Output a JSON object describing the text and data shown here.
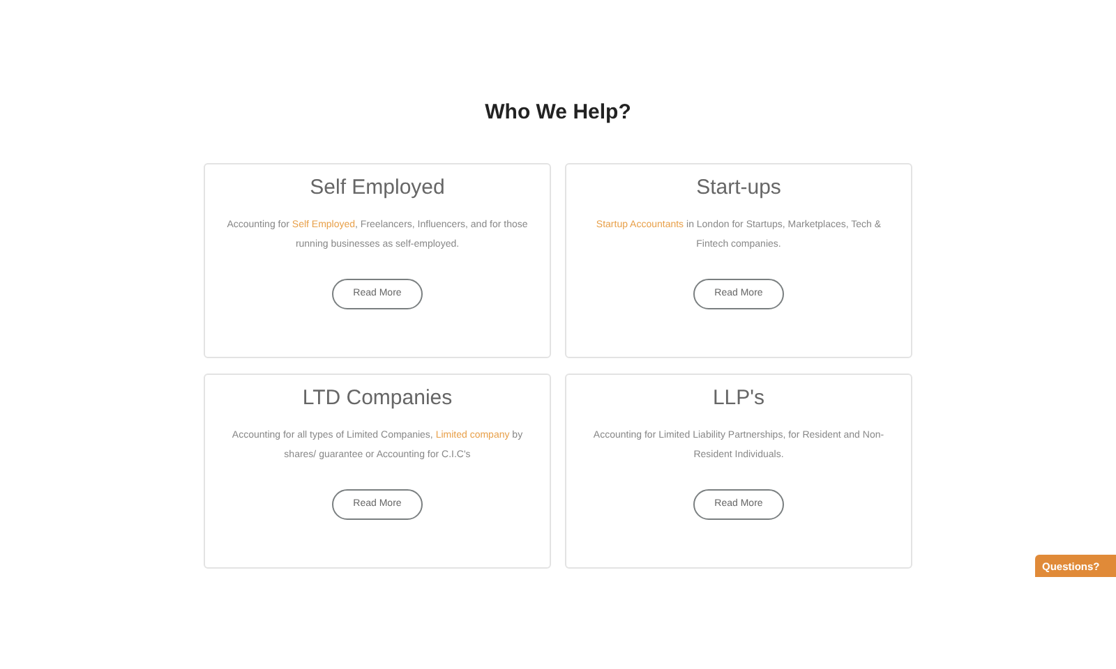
{
  "heading": "Who We Help?",
  "cards": [
    {
      "title": "Self Employed",
      "description": [
        {
          "text": "Accounting for ",
          "link": false
        },
        {
          "text": "Self Employed",
          "link": true
        },
        {
          "text": ", Freelancers, Influencers, and for those running businesses as self-employed.",
          "link": false
        }
      ],
      "button": "Read More"
    },
    {
      "title": "Start-ups",
      "description": [
        {
          "text": "Startup Accountants",
          "link": true
        },
        {
          "text": " in London for Startups, Marketplaces,  Tech & Fintech companies.",
          "link": false
        }
      ],
      "button": "Read More"
    },
    {
      "title": "LTD Companies",
      "description": [
        {
          "text": "Accounting for all types of Limited Companies, ",
          "link": false
        },
        {
          "text": "Limited company",
          "link": true
        },
        {
          "text": " by shares/ guarantee or Accounting for C.I.C's",
          "link": false
        }
      ],
      "button": "Read More"
    },
    {
      "title": "LLP's",
      "description": [
        {
          "text": "Accounting for Limited Liability Partnerships, for Resident and Non-Resident Individuals.",
          "link": false
        }
      ],
      "button": "Read More"
    }
  ],
  "questions_tab": "Questions?"
}
